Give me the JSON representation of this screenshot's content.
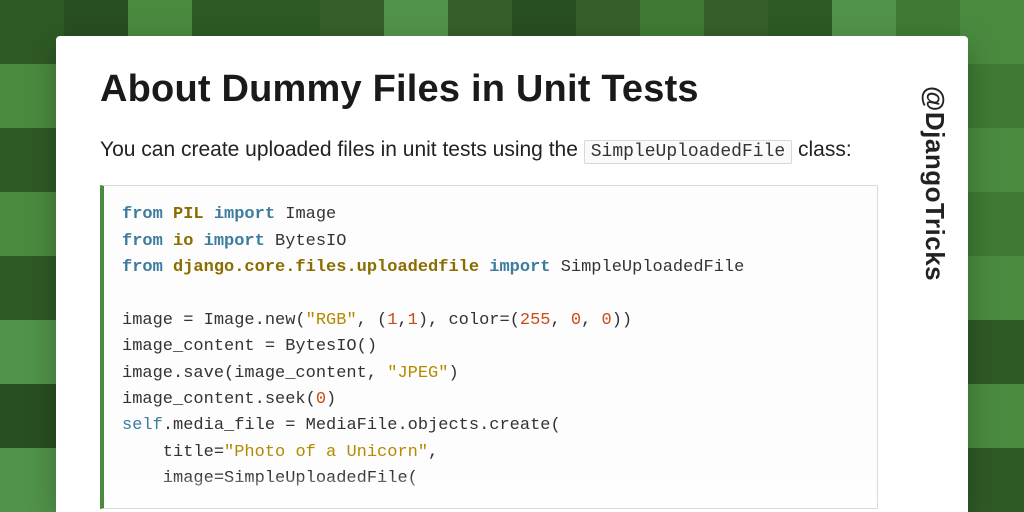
{
  "watermark": "@DjangoTricks",
  "title": "About Dummy Files in Unit Tests",
  "intro_pre": "You can create uploaded files in unit tests using the ",
  "intro_code": "SimpleUploadedFile",
  "intro_post": " class:",
  "code": {
    "l1_from": "from",
    "l1_mod": "PIL",
    "l1_import": "import",
    "l1_rest": " Image",
    "l2_from": "from",
    "l2_mod": "io",
    "l2_import": "import",
    "l2_rest": " BytesIO",
    "l3_from": "from",
    "l3_mod": "django.core.files.uploadedfile",
    "l3_import": "import",
    "l3_rest": " SimpleUploadedFile",
    "l5a": "image = Image.new(",
    "l5s1": "\"RGB\"",
    "l5b": ", (",
    "l5n1": "1",
    "l5c": ",",
    "l5n2": "1",
    "l5d": "), color=(",
    "l5n3": "255",
    "l5e": ", ",
    "l5n4": "0",
    "l5f": ", ",
    "l5n5": "0",
    "l5g": "))",
    "l6": "image_content = BytesIO()",
    "l7a": "image.save(image_content, ",
    "l7s": "\"JPEG\"",
    "l7b": ")",
    "l8a": "image_content.seek(",
    "l8n": "0",
    "l8b": ")",
    "l9self": "self",
    "l9a": ".media_file = MediaFile.objects.create(",
    "l10a": "    title=",
    "l10s": "\"Photo of a Unicorn\"",
    "l10b": ",",
    "l11": "    image=SimpleUploadedFile("
  }
}
